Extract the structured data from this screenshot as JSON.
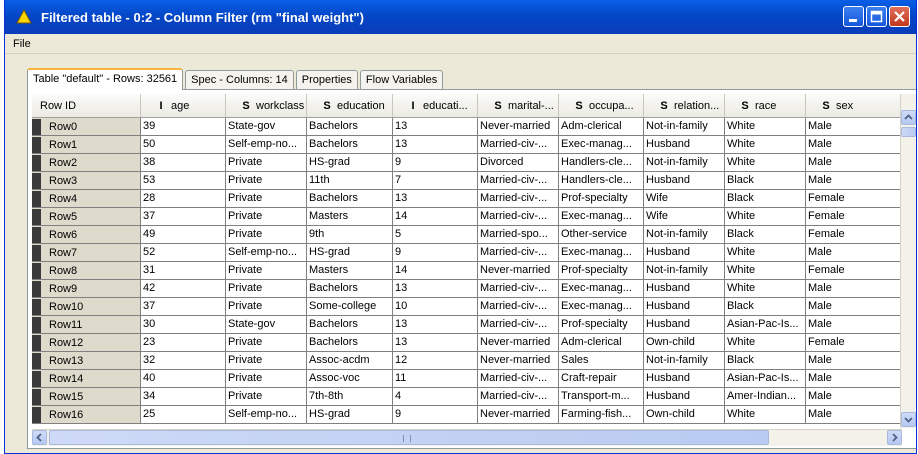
{
  "window": {
    "title": "Filtered table - 0:2 - Column Filter (rm \"final weight\")",
    "title_bar_color": "#0a55d8"
  },
  "menu": {
    "file": "File"
  },
  "tabs": [
    {
      "label": "Table \"default\" - Rows: 32561",
      "active": true
    },
    {
      "label": "Spec - Columns: 14",
      "active": false
    },
    {
      "label": "Properties",
      "active": false
    },
    {
      "label": "Flow Variables",
      "active": false
    }
  ],
  "table": {
    "columns": [
      {
        "label": "Row ID",
        "type": ""
      },
      {
        "label": "age",
        "type": "I"
      },
      {
        "label": "workclass",
        "type": "S"
      },
      {
        "label": "education",
        "type": "S"
      },
      {
        "label": "educati...",
        "type": "I"
      },
      {
        "label": "marital-...",
        "type": "S"
      },
      {
        "label": "occupa...",
        "type": "S"
      },
      {
        "label": "relation...",
        "type": "S"
      },
      {
        "label": "race",
        "type": "S"
      },
      {
        "label": "sex",
        "type": "S"
      }
    ],
    "rows": [
      [
        "Row0",
        "39",
        "State-gov",
        "Bachelors",
        "13",
        "Never-married",
        "Adm-clerical",
        "Not-in-family",
        "White",
        "Male"
      ],
      [
        "Row1",
        "50",
        "Self-emp-no...",
        "Bachelors",
        "13",
        "Married-civ-...",
        "Exec-manag...",
        "Husband",
        "White",
        "Male"
      ],
      [
        "Row2",
        "38",
        "Private",
        "HS-grad",
        "9",
        "Divorced",
        "Handlers-cle...",
        "Not-in-family",
        "White",
        "Male"
      ],
      [
        "Row3",
        "53",
        "Private",
        "11th",
        "7",
        "Married-civ-...",
        "Handlers-cle...",
        "Husband",
        "Black",
        "Male"
      ],
      [
        "Row4",
        "28",
        "Private",
        "Bachelors",
        "13",
        "Married-civ-...",
        "Prof-specialty",
        "Wife",
        "Black",
        "Female"
      ],
      [
        "Row5",
        "37",
        "Private",
        "Masters",
        "14",
        "Married-civ-...",
        "Exec-manag...",
        "Wife",
        "White",
        "Female"
      ],
      [
        "Row6",
        "49",
        "Private",
        "9th",
        "5",
        "Married-spo...",
        "Other-service",
        "Not-in-family",
        "Black",
        "Female"
      ],
      [
        "Row7",
        "52",
        "Self-emp-no...",
        "HS-grad",
        "9",
        "Married-civ-...",
        "Exec-manag...",
        "Husband",
        "White",
        "Male"
      ],
      [
        "Row8",
        "31",
        "Private",
        "Masters",
        "14",
        "Never-married",
        "Prof-specialty",
        "Not-in-family",
        "White",
        "Female"
      ],
      [
        "Row9",
        "42",
        "Private",
        "Bachelors",
        "13",
        "Married-civ-...",
        "Exec-manag...",
        "Husband",
        "White",
        "Male"
      ],
      [
        "Row10",
        "37",
        "Private",
        "Some-college",
        "10",
        "Married-civ-...",
        "Exec-manag...",
        "Husband",
        "Black",
        "Male"
      ],
      [
        "Row11",
        "30",
        "State-gov",
        "Bachelors",
        "13",
        "Married-civ-...",
        "Prof-specialty",
        "Husband",
        "Asian-Pac-Is...",
        "Male"
      ],
      [
        "Row12",
        "23",
        "Private",
        "Bachelors",
        "13",
        "Never-married",
        "Adm-clerical",
        "Own-child",
        "White",
        "Female"
      ],
      [
        "Row13",
        "32",
        "Private",
        "Assoc-acdm",
        "12",
        "Never-married",
        "Sales",
        "Not-in-family",
        "Black",
        "Male"
      ],
      [
        "Row14",
        "40",
        "Private",
        "Assoc-voc",
        "11",
        "Married-civ-...",
        "Craft-repair",
        "Husband",
        "Asian-Pac-Is...",
        "Male"
      ],
      [
        "Row15",
        "34",
        "Private",
        "7th-8th",
        "4",
        "Married-civ-...",
        "Transport-m...",
        "Husband",
        "Amer-Indian...",
        "Male"
      ],
      [
        "Row16",
        "25",
        "Self-emp-no...",
        "HS-grad",
        "9",
        "Never-married",
        "Farming-fish...",
        "Own-child",
        "White",
        "Male"
      ]
    ]
  }
}
